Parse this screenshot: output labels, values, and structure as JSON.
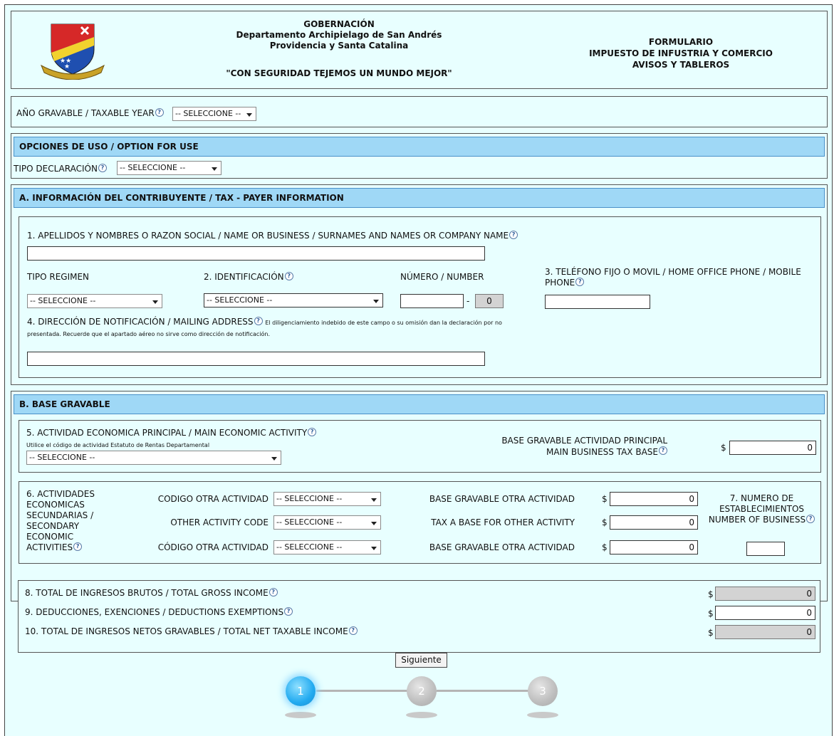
{
  "header": {
    "line1": "GOBERNACIÓN",
    "line2": "Departamento Archipielago de San Andrés",
    "line3": "Providencia y Santa Catalina",
    "slogan": "\"CON SEGURIDAD TEJEMOS UN MUNDO MEJOR\"",
    "form_line1": "FORMULARIO",
    "form_line2": "IMPUESTO DE INFUSTRIA Y COMERCIO",
    "form_line3": "AVISOS Y TABLEROS"
  },
  "taxable_year": {
    "label": "AÑO GRAVABLE / TAXABLE YEAR",
    "value": "-- SELECCIONE --"
  },
  "options": {
    "title": "OPCIONES DE USO / OPTION FOR USE",
    "tipo_label": "TIPO DECLARACIÓN",
    "tipo_value": "-- SELECCIONE --"
  },
  "section_a": {
    "title": "A. INFORMACIÓN DEL CONTRIBUYENTE / TAX - PAYER INFORMATION",
    "name_label": "1. APELLIDOS Y NOMBRES O RAZON SOCIAL / NAME OR BUSINESS / SURNAMES AND NAMES OR COMPANY NAME",
    "name_value": "",
    "regimen_label": "TIPO REGIMEN",
    "regimen_value": "-- SELECCIONE --",
    "id_label": "2. IDENTIFICACIÓN",
    "id_value": "-- SELECCIONE --",
    "number_label": "NÚMERO / NUMBER",
    "number_value": "",
    "number_dash": "-",
    "check_digit": "0",
    "phone_label_1": "3. TELÉFONO FIJO O MOVIL / HOME OFFICE PHONE / MOBILE",
    "phone_label_2": "PHONE",
    "phone_value": "",
    "address_label": "4. DIRECCIÓN DE NOTIFICACIÓN / MAILING ADDRESS",
    "address_note_1": "El diligenciamiento indebido de este campo o su omisión dan la declaración por no",
    "address_note_2": "presentada. Recuerde que el apartado aéreo no sirve como dirección de notificación.",
    "address_value": ""
  },
  "section_b": {
    "title": "B. BASE GRAVABLE",
    "main_activity_label": "5. ACTIVIDAD ECONOMICA PRINCIPAL / MAIN ECONOMIC ACTIVITY",
    "main_activity_note": "Utilice el código de actividad Estatuto de Rentas Departamental",
    "main_activity_value": "-- SELECCIONE --",
    "main_base_label_1": "BASE GRAVABLE ACTIVIDAD PRINCIPAL",
    "main_base_label_2": "MAIN BUSINESS TAX BASE",
    "currency": "$",
    "main_base_value": "0",
    "secondary_label": [
      "6. ACTIVIDADES",
      "ECONOMICAS",
      "SECUNDARIAS /",
      "SECONDARY",
      "ECONOMIC",
      "ACTIVITIES"
    ],
    "secondary_rows": [
      {
        "code_label": "CODIGO OTRA ACTIVIDAD",
        "code_value": "-- SELECCIONE --",
        "base_label": "BASE GRAVABLE OTRA ACTIVIDAD",
        "base_value": "0"
      },
      {
        "code_label": "OTHER ACTIVITY CODE",
        "code_value": "-- SELECCIONE --",
        "base_label": "TAX A BASE FOR OTHER ACTIVITY",
        "base_value": "0"
      },
      {
        "code_label": "CÓDIGO OTRA ACTIVIDAD",
        "code_value": "-- SELECCIONE --",
        "base_label": "BASE GRAVABLE OTRA ACTIVIDAD",
        "base_value": "0"
      }
    ],
    "establishments_label_1": "7. NUMERO DE",
    "establishments_label_2": "ESTABLECIMIENTOS",
    "establishments_label_3": "NUMBER OF BUSINESS",
    "establishments_value": "",
    "total_gross_label": "8. TOTAL DE INGRESOS BRUTOS / TOTAL GROSS INCOME",
    "total_gross_value": "0",
    "deductions_label": "9. DEDUCCIONES, EXENCIONES / DEDUCTIONS EXEMPTIONS",
    "deductions_value": "0",
    "net_taxable_label": "10. TOTAL DE INGRESOS NETOS GRAVABLES / TOTAL NET TAXABLE INCOME",
    "net_taxable_value": "0"
  },
  "next_button": "Siguiente",
  "steps": [
    "1",
    "2",
    "3"
  ],
  "help_glyph": "?"
}
